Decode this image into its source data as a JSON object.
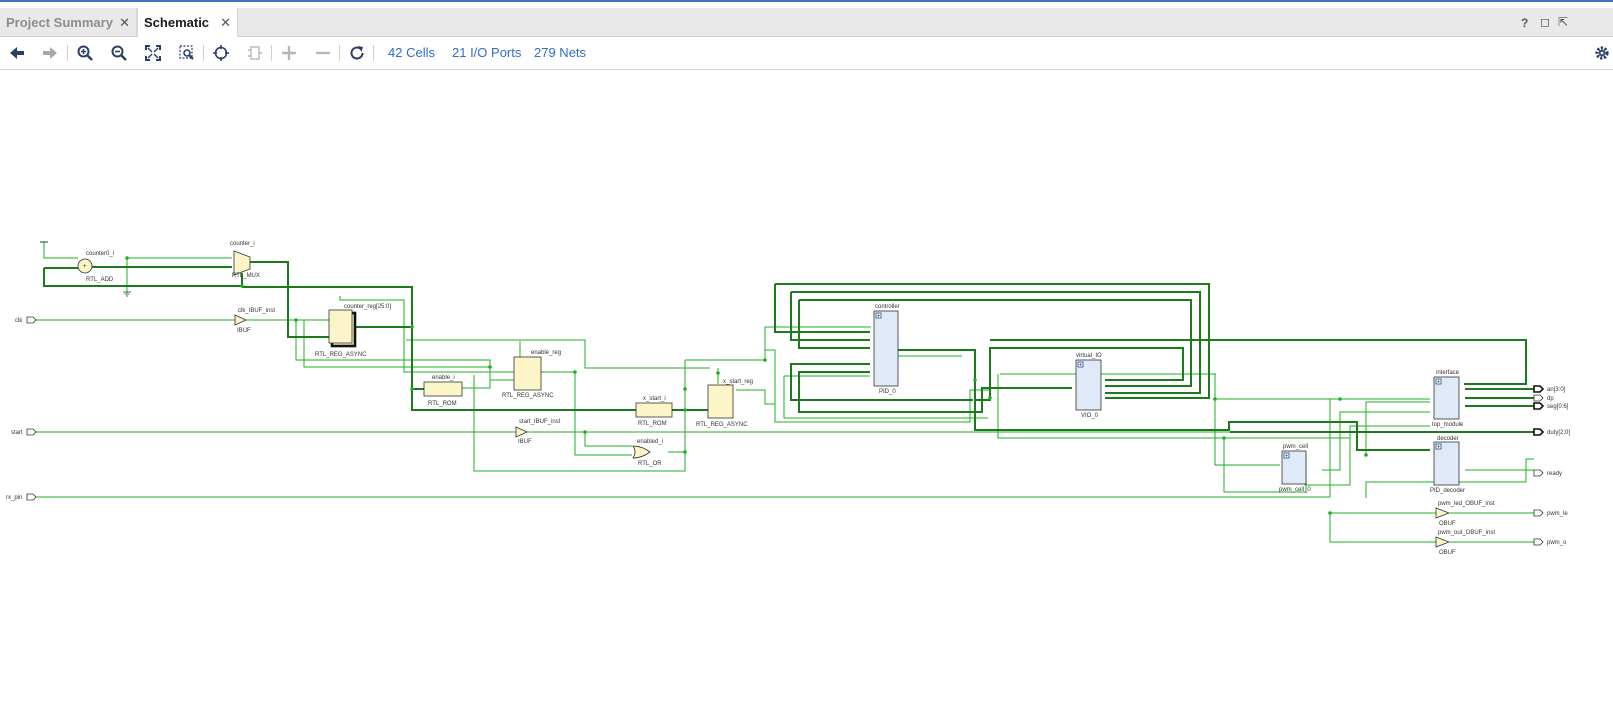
{
  "tabs": [
    {
      "label": "Project Summary"
    },
    {
      "label": "Schematic"
    }
  ],
  "window_controls": {
    "help": "?",
    "restore": "◻",
    "float": "⇱"
  },
  "toolbar": {
    "stats": {
      "cells": "42 Cells",
      "io_ports": "21 I/O Ports",
      "nets": "279 Nets"
    },
    "icons": [
      "back-arrow-icon",
      "forward-arrow-icon",
      "zoom-in-icon",
      "zoom-out-icon",
      "zoom-fit-icon",
      "zoom-area-icon",
      "select-icon",
      "regenerate-icon",
      "expand-icon",
      "collapse-icon",
      "refresh-icon",
      "settings-gear-icon"
    ]
  },
  "schematic": {
    "input_ports": [
      "clk",
      "start",
      "rx_pin"
    ],
    "output_ports": [
      "an[3:0]",
      "dp",
      "seg[0:6]",
      "duty[2:0]",
      "ready",
      "pwm_le",
      "pwm_o"
    ],
    "cells": [
      {
        "name": "counter0_i",
        "type": "RTL_ADD"
      },
      {
        "name": "counter_i",
        "type": "RTL_MUX"
      },
      {
        "name": "clk_IBUF_inst",
        "type": "IBUF"
      },
      {
        "name": "counter_reg[25:0]",
        "type": "RTL_REG_ASYNC"
      },
      {
        "name": "enable_i",
        "type": "RTL_ROM"
      },
      {
        "name": "enable_reg",
        "type": "RTL_REG_ASYNC"
      },
      {
        "name": "x_start_i",
        "type": "RTL_ROM"
      },
      {
        "name": "x_start_reg",
        "type": "RTL_REG_ASYNC"
      },
      {
        "name": "start_IBUF_inst",
        "type": "IBUF"
      },
      {
        "name": "enabled_i",
        "type": "RTL_OR"
      },
      {
        "name": "controller",
        "type": "PID_0"
      },
      {
        "name": "virtual_IO",
        "type": "VIO_0"
      },
      {
        "name": "interface",
        "type": "top_module"
      },
      {
        "name": "decoder",
        "type": "PID_decoder"
      },
      {
        "name": "pwm_cell",
        "type": "pwm_cell_0"
      },
      {
        "name": "pwm_led_OBUF_inst",
        "type": "OBUF"
      },
      {
        "name": "pwm_out_OBUF_inst",
        "type": "OBUF"
      }
    ],
    "colors": {
      "wire": "#1fb01f",
      "bus": "#1c7a1c",
      "primitive_fill": "#fbf5c8",
      "hier_fill": "#dfe9f7"
    }
  }
}
